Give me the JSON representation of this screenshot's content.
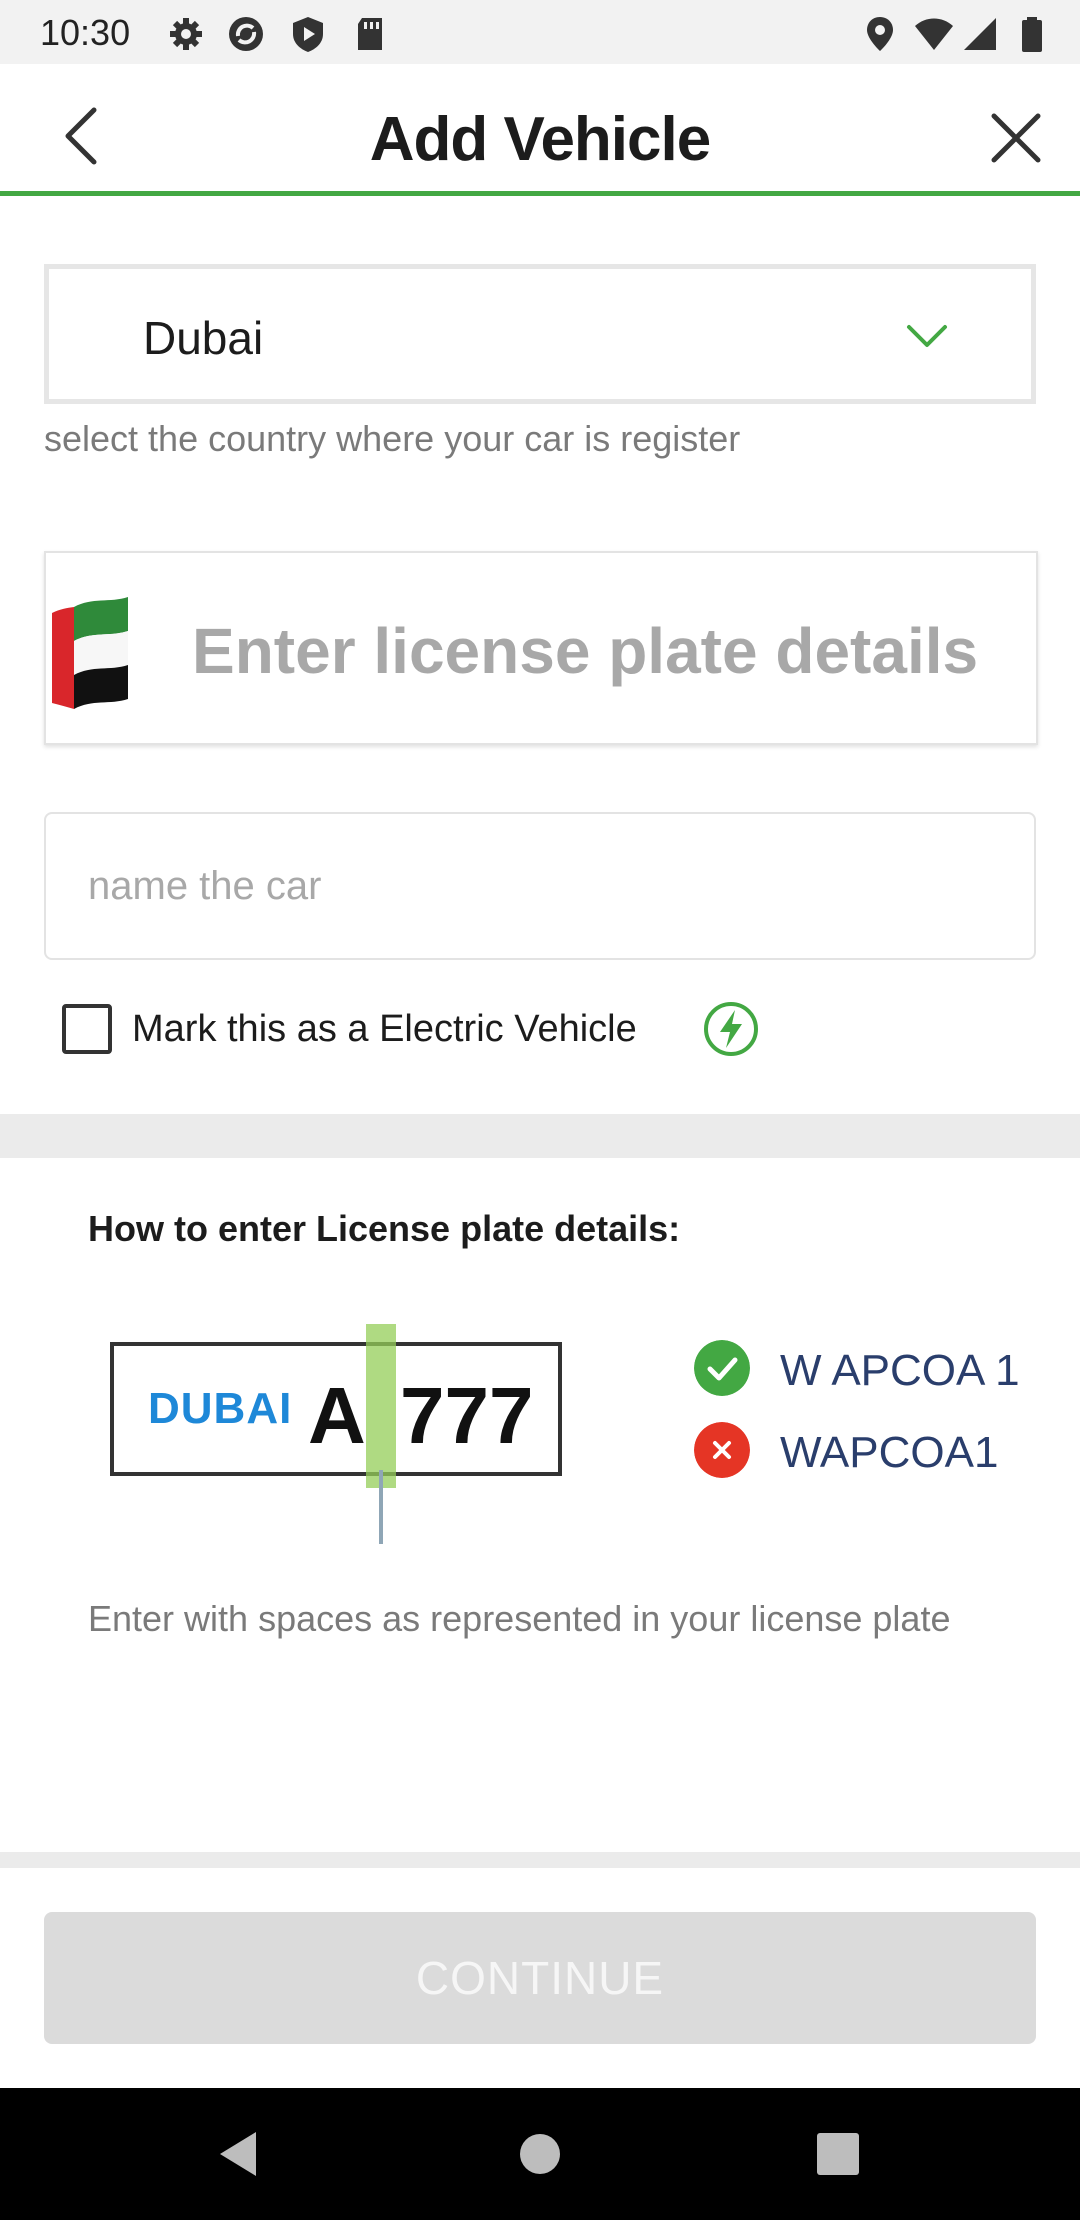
{
  "status_bar": {
    "time": "10:30",
    "left_icons": [
      "gear-icon",
      "sync-icon",
      "shield-play-icon",
      "sd-card-icon"
    ],
    "right_icons": [
      "location-icon",
      "wifi-icon",
      "signal-icon",
      "battery-icon"
    ]
  },
  "header": {
    "title": "Add Vehicle",
    "back_icon": "chevron-left-icon",
    "close_icon": "close-icon",
    "accent_color": "#43a843"
  },
  "form": {
    "country": {
      "selected": "Dubai",
      "help_text": "select the country where your car is register"
    },
    "license_plate": {
      "placeholder": "Enter license plate details",
      "flag_icon": "uae-flag-icon"
    },
    "car_name": {
      "placeholder": "name the car"
    },
    "electric": {
      "label": "Mark this as a Electric Vehicle",
      "checked": false,
      "icon": "lightning-icon"
    }
  },
  "help": {
    "title": "How to enter License plate details:",
    "example_plate": {
      "emirate": "DUBAI",
      "letter": "A",
      "number": "777"
    },
    "correct_example": "W APCOA 1",
    "incorrect_example": "WAPCOA1",
    "correct_color": "#43a843",
    "incorrect_color": "#e53525",
    "note": "Enter with spaces as represented in your license plate"
  },
  "actions": {
    "continue_label": "CONTINUE"
  }
}
